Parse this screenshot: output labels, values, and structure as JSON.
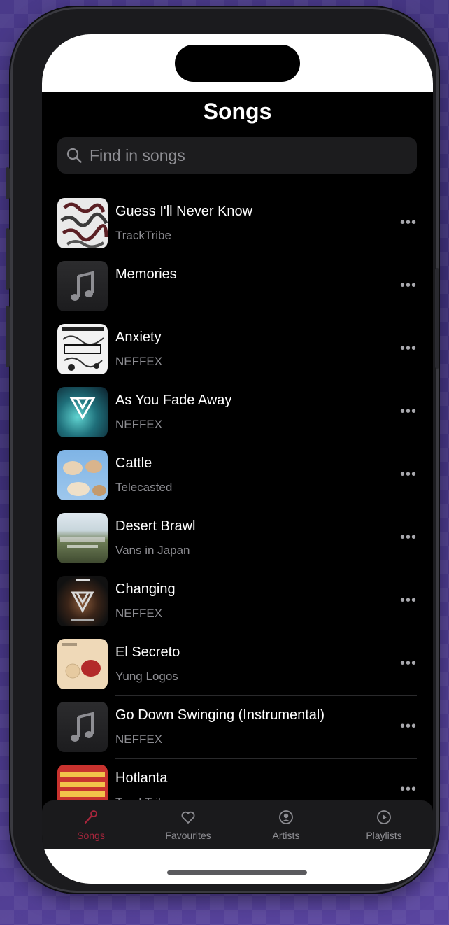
{
  "header": {
    "title": "Songs"
  },
  "search": {
    "placeholder": "Find in songs"
  },
  "songs": [
    {
      "title": "Guess I'll Never Know",
      "artist": "TrackTribe",
      "art": "art-guess"
    },
    {
      "title": "Memories",
      "artist": "",
      "art": "note"
    },
    {
      "title": "Anxiety",
      "artist": "NEFFEX",
      "art": "art-anxiety"
    },
    {
      "title": "As You Fade Away",
      "artist": "NEFFEX",
      "art": "art-fade"
    },
    {
      "title": "Cattle",
      "artist": "Telecasted",
      "art": "art-cattle"
    },
    {
      "title": "Desert Brawl",
      "artist": "Vans in Japan",
      "art": "art-desert"
    },
    {
      "title": "Changing",
      "artist": "NEFFEX",
      "art": "art-changing"
    },
    {
      "title": "El Secreto",
      "artist": "Yung Logos",
      "art": "art-secreto"
    },
    {
      "title": "Go Down Swinging (Instrumental)",
      "artist": "NEFFEX",
      "art": "note"
    },
    {
      "title": "Hotlanta",
      "artist": "TrackTribe",
      "art": "art-hotlanta"
    }
  ],
  "more_label": "•••",
  "tabs": [
    {
      "label": "Songs",
      "icon": "microphone-icon",
      "active": true
    },
    {
      "label": "Favourites",
      "icon": "heart-icon",
      "active": false
    },
    {
      "label": "Artists",
      "icon": "person-circle-icon",
      "active": false
    },
    {
      "label": "Playlists",
      "icon": "play-circle-icon",
      "active": false
    }
  ],
  "colors": {
    "accent": "#a8263c",
    "background": "#000000",
    "secondary_text": "#8e8e93"
  }
}
